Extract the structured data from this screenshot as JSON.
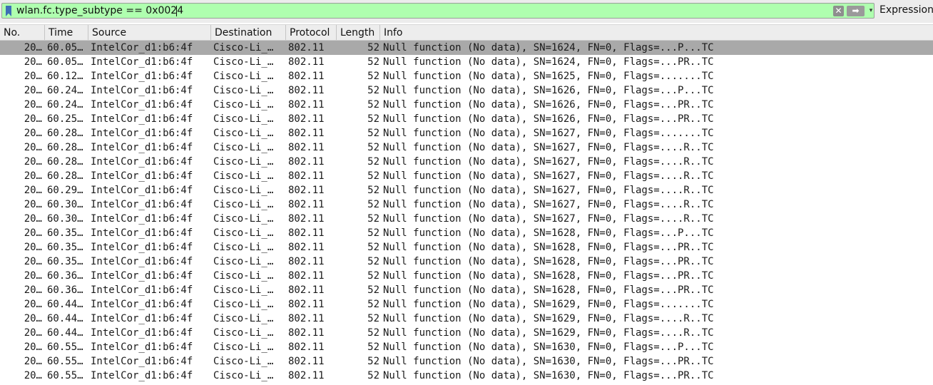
{
  "filter": {
    "value": "wlan.fc.type_subtype == 0x0024",
    "expression_label": "Expression...",
    "clear_glyph": "✕",
    "apply_glyph": "➡",
    "recent_glyph": "▾",
    "bg_color": "#afffaf"
  },
  "columns": [
    "No.",
    "Time",
    "Source",
    "Destination",
    "Protocol",
    "Length",
    "Info"
  ],
  "selected_row": 0,
  "packets": [
    {
      "no": "20…",
      "time": "60.05…",
      "source": "IntelCor_d1:b6:4f",
      "destination": "Cisco-Li_…",
      "protocol": "802.11",
      "length": "52",
      "info": "Null function (No data), SN=1624, FN=0, Flags=...P...TC"
    },
    {
      "no": "20…",
      "time": "60.05…",
      "source": "IntelCor_d1:b6:4f",
      "destination": "Cisco-Li_…",
      "protocol": "802.11",
      "length": "52",
      "info": "Null function (No data), SN=1624, FN=0, Flags=...PR..TC"
    },
    {
      "no": "20…",
      "time": "60.12…",
      "source": "IntelCor_d1:b6:4f",
      "destination": "Cisco-Li_…",
      "protocol": "802.11",
      "length": "52",
      "info": "Null function (No data), SN=1625, FN=0, Flags=.......TC"
    },
    {
      "no": "20…",
      "time": "60.24…",
      "source": "IntelCor_d1:b6:4f",
      "destination": "Cisco-Li_…",
      "protocol": "802.11",
      "length": "52",
      "info": "Null function (No data), SN=1626, FN=0, Flags=...P...TC"
    },
    {
      "no": "20…",
      "time": "60.24…",
      "source": "IntelCor_d1:b6:4f",
      "destination": "Cisco-Li_…",
      "protocol": "802.11",
      "length": "52",
      "info": "Null function (No data), SN=1626, FN=0, Flags=...PR..TC"
    },
    {
      "no": "20…",
      "time": "60.25…",
      "source": "IntelCor_d1:b6:4f",
      "destination": "Cisco-Li_…",
      "protocol": "802.11",
      "length": "52",
      "info": "Null function (No data), SN=1626, FN=0, Flags=...PR..TC"
    },
    {
      "no": "20…",
      "time": "60.28…",
      "source": "IntelCor_d1:b6:4f",
      "destination": "Cisco-Li_…",
      "protocol": "802.11",
      "length": "52",
      "info": "Null function (No data), SN=1627, FN=0, Flags=.......TC"
    },
    {
      "no": "20…",
      "time": "60.28…",
      "source": "IntelCor_d1:b6:4f",
      "destination": "Cisco-Li_…",
      "protocol": "802.11",
      "length": "52",
      "info": "Null function (No data), SN=1627, FN=0, Flags=....R..TC"
    },
    {
      "no": "20…",
      "time": "60.28…",
      "source": "IntelCor_d1:b6:4f",
      "destination": "Cisco-Li_…",
      "protocol": "802.11",
      "length": "52",
      "info": "Null function (No data), SN=1627, FN=0, Flags=....R..TC"
    },
    {
      "no": "20…",
      "time": "60.28…",
      "source": "IntelCor_d1:b6:4f",
      "destination": "Cisco-Li_…",
      "protocol": "802.11",
      "length": "52",
      "info": "Null function (No data), SN=1627, FN=0, Flags=....R..TC"
    },
    {
      "no": "20…",
      "time": "60.29…",
      "source": "IntelCor_d1:b6:4f",
      "destination": "Cisco-Li_…",
      "protocol": "802.11",
      "length": "52",
      "info": "Null function (No data), SN=1627, FN=0, Flags=....R..TC"
    },
    {
      "no": "20…",
      "time": "60.30…",
      "source": "IntelCor_d1:b6:4f",
      "destination": "Cisco-Li_…",
      "protocol": "802.11",
      "length": "52",
      "info": "Null function (No data), SN=1627, FN=0, Flags=....R..TC"
    },
    {
      "no": "20…",
      "time": "60.30…",
      "source": "IntelCor_d1:b6:4f",
      "destination": "Cisco-Li_…",
      "protocol": "802.11",
      "length": "52",
      "info": "Null function (No data), SN=1627, FN=0, Flags=....R..TC"
    },
    {
      "no": "20…",
      "time": "60.35…",
      "source": "IntelCor_d1:b6:4f",
      "destination": "Cisco-Li_…",
      "protocol": "802.11",
      "length": "52",
      "info": "Null function (No data), SN=1628, FN=0, Flags=...P...TC"
    },
    {
      "no": "20…",
      "time": "60.35…",
      "source": "IntelCor_d1:b6:4f",
      "destination": "Cisco-Li_…",
      "protocol": "802.11",
      "length": "52",
      "info": "Null function (No data), SN=1628, FN=0, Flags=...PR..TC"
    },
    {
      "no": "20…",
      "time": "60.35…",
      "source": "IntelCor_d1:b6:4f",
      "destination": "Cisco-Li_…",
      "protocol": "802.11",
      "length": "52",
      "info": "Null function (No data), SN=1628, FN=0, Flags=...PR..TC"
    },
    {
      "no": "20…",
      "time": "60.36…",
      "source": "IntelCor_d1:b6:4f",
      "destination": "Cisco-Li_…",
      "protocol": "802.11",
      "length": "52",
      "info": "Null function (No data), SN=1628, FN=0, Flags=...PR..TC"
    },
    {
      "no": "20…",
      "time": "60.36…",
      "source": "IntelCor_d1:b6:4f",
      "destination": "Cisco-Li_…",
      "protocol": "802.11",
      "length": "52",
      "info": "Null function (No data), SN=1628, FN=0, Flags=...PR..TC"
    },
    {
      "no": "20…",
      "time": "60.44…",
      "source": "IntelCor_d1:b6:4f",
      "destination": "Cisco-Li_…",
      "protocol": "802.11",
      "length": "52",
      "info": "Null function (No data), SN=1629, FN=0, Flags=.......TC"
    },
    {
      "no": "20…",
      "time": "60.44…",
      "source": "IntelCor_d1:b6:4f",
      "destination": "Cisco-Li_…",
      "protocol": "802.11",
      "length": "52",
      "info": "Null function (No data), SN=1629, FN=0, Flags=....R..TC"
    },
    {
      "no": "20…",
      "time": "60.44…",
      "source": "IntelCor_d1:b6:4f",
      "destination": "Cisco-Li_…",
      "protocol": "802.11",
      "length": "52",
      "info": "Null function (No data), SN=1629, FN=0, Flags=....R..TC"
    },
    {
      "no": "20…",
      "time": "60.55…",
      "source": "IntelCor_d1:b6:4f",
      "destination": "Cisco-Li_…",
      "protocol": "802.11",
      "length": "52",
      "info": "Null function (No data), SN=1630, FN=0, Flags=...P...TC"
    },
    {
      "no": "20…",
      "time": "60.55…",
      "source": "IntelCor_d1:b6:4f",
      "destination": "Cisco-Li_…",
      "protocol": "802.11",
      "length": "52",
      "info": "Null function (No data), SN=1630, FN=0, Flags=...PR..TC"
    },
    {
      "no": "20…",
      "time": "60.55…",
      "source": "IntelCor_d1:b6:4f",
      "destination": "Cisco-Li_…",
      "protocol": "802.11",
      "length": "52",
      "info": "Null function (No data), SN=1630, FN=0, Flags=...PR..TC"
    }
  ]
}
